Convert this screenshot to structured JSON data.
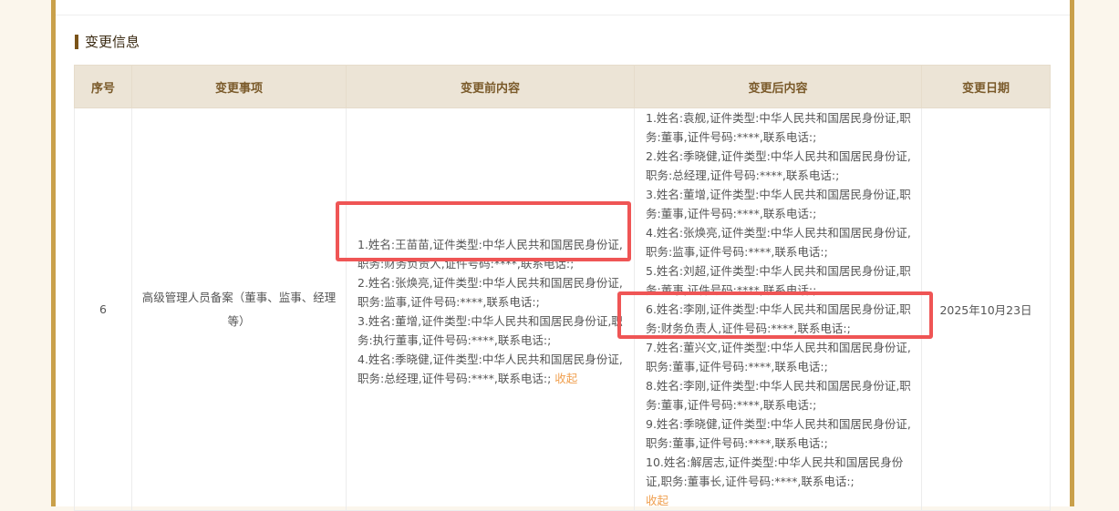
{
  "section_title": "变更信息",
  "columns": {
    "seq": "序号",
    "item": "变更事项",
    "before": "变更前内容",
    "after": "变更后内容",
    "date": "变更日期"
  },
  "row": {
    "seq": "6",
    "item": "高级管理人员备案（董事、监事、经理等）",
    "before": [
      "1.姓名:王苗苗,证件类型:中华人民共和国居民身份证,职务:财务负责人,证件号码:****,联系电话:;",
      "2.姓名:张焕亮,证件类型:中华人民共和国居民身份证,职务:监事,证件号码:****,联系电话:;",
      "3.姓名:董增,证件类型:中华人民共和国居民身份证,职务:执行董事,证件号码:****,联系电话:;",
      "4.姓名:季晓健,证件类型:中华人民共和国居民身份证,职务:总经理,证件号码:****,联系电话:;"
    ],
    "after": [
      "1.姓名:袁舰,证件类型:中华人民共和国居民身份证,职务:董事,证件号码:****,联系电话:;",
      "2.姓名:季晓健,证件类型:中华人民共和国居民身份证,职务:总经理,证件号码:****,联系电话:;",
      "3.姓名:董增,证件类型:中华人民共和国居民身份证,职务:董事,证件号码:****,联系电话:;",
      "4.姓名:张焕亮,证件类型:中华人民共和国居民身份证,职务:监事,证件号码:****,联系电话:;",
      "5.姓名:刘超,证件类型:中华人民共和国居民身份证,职务:董事,证件号码:****,联系电话:;",
      "6.姓名:李刚,证件类型:中华人民共和国居民身份证,职务:财务负责人,证件号码:****,联系电话:;",
      "7.姓名:董兴文,证件类型:中华人民共和国居民身份证,职务:董事,证件号码:****,联系电话:;",
      "8.姓名:李刚,证件类型:中华人民共和国居民身份证,职务:董事,证件号码:****,联系电话:;",
      "9.姓名:季晓健,证件类型:中华人民共和国居民身份证,职务:董事,证件号码:****,联系电话:;",
      "10.姓名:解居志,证件类型:中华人民共和国居民身份证,职务:董事长,证件号码:****,联系电话:;"
    ],
    "collapse_label": "收起",
    "date": "2025年10月23日"
  },
  "colors": {
    "accent_gold": "#c9a04a",
    "header_bg": "#ece4d6",
    "link_orange": "#f0a050",
    "highlight_red": "#ef5555"
  }
}
